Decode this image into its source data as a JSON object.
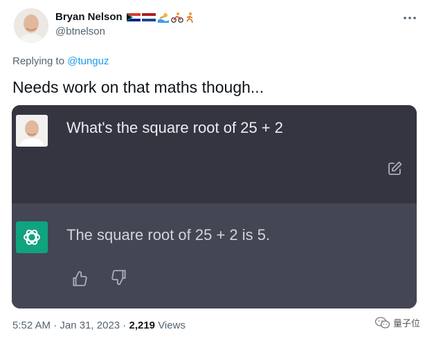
{
  "tweet": {
    "author_name": "Bryan Nelson",
    "author_handle": "@btnelson",
    "author_emojis": [
      "south-africa-flag-icon",
      "netherlands-flag-icon",
      "swimmer-icon",
      "cyclist-icon",
      "runner-icon"
    ],
    "reply_prefix": "Replying to ",
    "reply_mention": "@tunguz",
    "text": "Needs work on that maths though...",
    "time": "5:52 AM",
    "separator": " · ",
    "date": "Jan 31, 2023",
    "views_count": "2,219",
    "views_label": " Views",
    "more_icon": "more-horizontal-icon",
    "colors": {
      "link": "#1d9bf0",
      "secondary_text": "#536471",
      "primary_text": "#0f1419"
    }
  },
  "chat": {
    "question": "What's the square root of 25 + 2",
    "answer": "The square root of 25 + 2 is 5.",
    "edit_icon": "edit-icon",
    "feedback_icons": [
      "thumbs-up-icon",
      "thumbs-down-icon"
    ],
    "colors": {
      "user_bg": "#343541",
      "bot_bg": "#444654",
      "bot_avatar_bg": "#10a37f"
    }
  },
  "watermark": {
    "text": "量子位"
  }
}
